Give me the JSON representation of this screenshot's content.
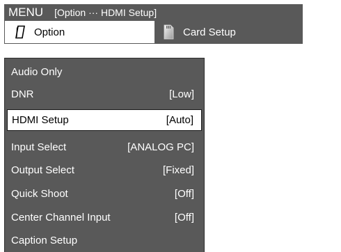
{
  "header": {
    "menu_label": "MENU",
    "breadcrumb": "[Option ··· HDMI Setup]"
  },
  "tabs": [
    {
      "label": "Option",
      "icon": "option-icon",
      "active": true
    },
    {
      "label": "Card Setup",
      "icon": "card-setup-icon",
      "active": false
    }
  ],
  "menu_items": [
    {
      "label": "Audio Only",
      "value": ""
    },
    {
      "label": "DNR",
      "value": "[Low]"
    },
    {
      "label": "HDMI Setup",
      "value": "[Auto]",
      "selected": true
    },
    {
      "label": "Input Select",
      "value": "[ANALOG PC]"
    },
    {
      "label": "Output Select",
      "value": "[Fixed]"
    },
    {
      "label": "Quick Shoot",
      "value": "[Off]"
    },
    {
      "label": "Center Channel Input",
      "value": "[Off]"
    },
    {
      "label": "Caption Setup",
      "value": ""
    }
  ],
  "colors": {
    "panel": "#595959",
    "highlight": "#ffffff",
    "text_on_panel": "#ffffff",
    "text_on_highlight": "#000000"
  }
}
